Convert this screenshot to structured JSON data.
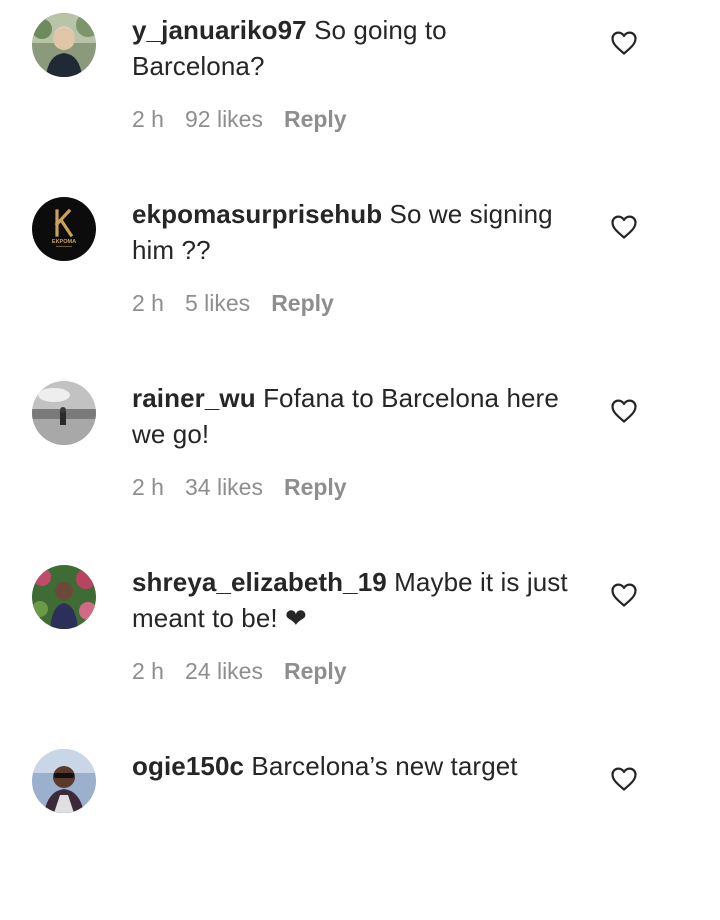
{
  "comments": [
    {
      "username": "y_januariko97",
      "text": "So going to Barcelona?",
      "time": "2 h",
      "likes": "92 likes",
      "reply_label": "Reply",
      "avatar_icon": "profile-photo-person-outdoors"
    },
    {
      "username": "ekpomasurprisehub",
      "text": "So we signing him ??",
      "time": "2 h",
      "likes": "5 likes",
      "reply_label": "Reply",
      "avatar_icon": "ekpoma-logo",
      "avatar_logo_text": "EKPOMA"
    },
    {
      "username": "rainer_wu",
      "text": "Fofana to Barcelona here we go!",
      "time": "2 h",
      "likes": "34 likes",
      "reply_label": "Reply",
      "avatar_icon": "profile-photo-bw-sea"
    },
    {
      "username": "shreya_elizabeth_19",
      "text": "Maybe it is just meant to be! ❤",
      "time": "2 h",
      "likes": "24 likes",
      "reply_label": "Reply",
      "avatar_icon": "profile-photo-person-flowers"
    },
    {
      "username": "ogie150c",
      "text": "Barcelona’s new target",
      "time": "",
      "likes": "",
      "reply_label": "",
      "avatar_icon": "profile-photo-person-sunglasses"
    }
  ],
  "colors": {
    "text": "#262626",
    "secondary": "#8e8e8e",
    "background": "#ffffff"
  },
  "icons": {
    "like": "heart-outline-icon"
  }
}
